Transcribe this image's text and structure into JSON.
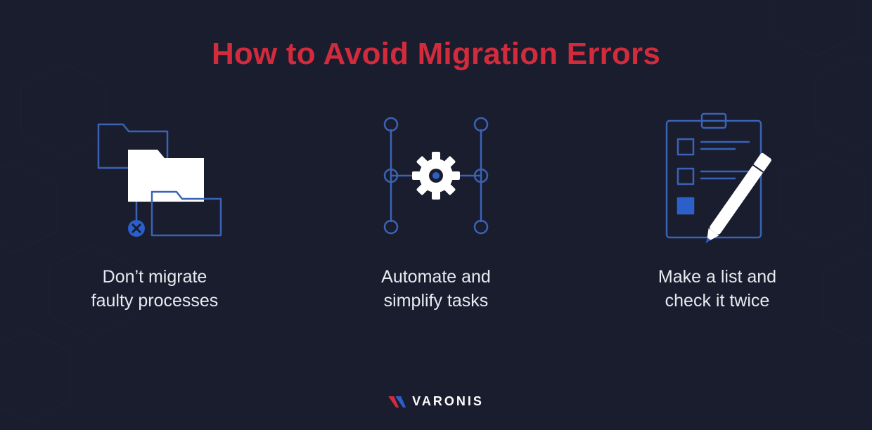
{
  "title": "How to Avoid Migration Errors",
  "colors": {
    "background": "#1a1d2e",
    "accent_red": "#d22b3c",
    "accent_blue": "#2b5fca",
    "stroke_blue": "#3a63b5",
    "text": "#e8eaf0",
    "white": "#ffffff"
  },
  "cards": [
    {
      "icon": "folders-error-icon",
      "caption": "Don’t migrate\nfaulty processes"
    },
    {
      "icon": "automation-gear-icon",
      "caption": "Automate and\nsimplify tasks"
    },
    {
      "icon": "checklist-pen-icon",
      "caption": "Make a list and\ncheck it twice"
    }
  ],
  "brand": {
    "name": "VARONIS",
    "mark_colors": {
      "red": "#d22b3c",
      "blue": "#2b5fca"
    }
  }
}
